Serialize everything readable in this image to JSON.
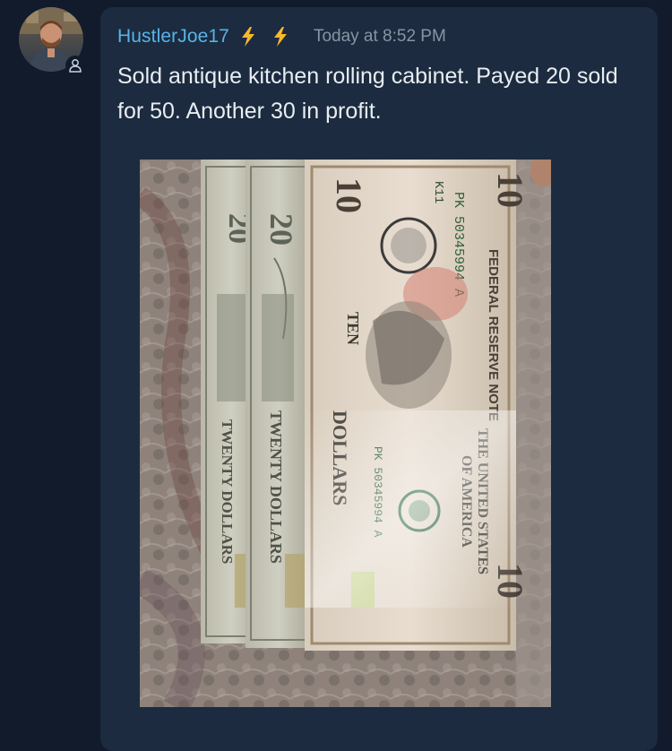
{
  "post": {
    "username": "HustlerJoe17",
    "badges": [
      "lightning-bolt-icon",
      "lightning-bolt-icon"
    ],
    "timestamp": "Today at 8:52 PM",
    "message": "Sold antique kitchen rolling cabinet. Payed 20 sold for 50. Another 30 in profit."
  },
  "photo": {
    "bills": [
      {
        "denomination": "20",
        "front_text": "TWENTY DOLLARS"
      },
      {
        "denomination": "20",
        "front_text": "TWENTY DOLLARS"
      },
      {
        "denomination": "10",
        "front_text": "TEN DOLLARS",
        "serial": "PK 50345994 A",
        "district": "K11",
        "banner": "FEDERAL RESERVE NOTE",
        "country": "THE UNITED STATES OF AMERICA"
      }
    ]
  },
  "colors": {
    "background": "#111b2c",
    "card": "#1c2b3f",
    "username": "#58b3e8",
    "badge": "#f5b82e",
    "timestamp": "#8994a4",
    "text": "#e9edf2"
  }
}
